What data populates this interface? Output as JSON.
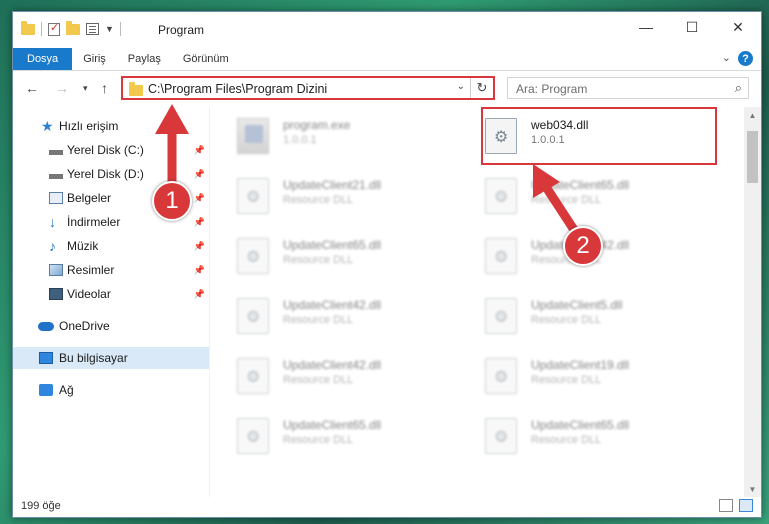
{
  "window": {
    "title": "Program",
    "controls": {
      "minimize": "—",
      "maximize": "☐",
      "close": "✕"
    }
  },
  "ribbon": {
    "tabs": [
      "Dosya",
      "Giriş",
      "Paylaş",
      "Görünüm"
    ],
    "help": "?"
  },
  "address": {
    "path": "C:\\Program Files\\Program Dizini",
    "search_placeholder": "Ara: Program"
  },
  "sidebar": {
    "items": [
      {
        "label": "Hızlı erişim",
        "icon": "star-icon"
      },
      {
        "label": "Yerel Disk (C:)",
        "icon": "disk-icon",
        "pinned": true
      },
      {
        "label": "Yerel Disk (D:)",
        "icon": "disk-icon",
        "pinned": true
      },
      {
        "label": "Belgeler",
        "icon": "documents-icon",
        "pinned": true
      },
      {
        "label": "İndirmeler",
        "icon": "download-icon",
        "pinned": true
      },
      {
        "label": "Müzik",
        "icon": "music-icon",
        "pinned": true
      },
      {
        "label": "Resimler",
        "icon": "pictures-icon",
        "pinned": true
      },
      {
        "label": "Videolar",
        "icon": "videos-icon",
        "pinned": true
      },
      {
        "label": "OneDrive",
        "icon": "cloud-icon"
      },
      {
        "label": "Bu bilgisayar",
        "icon": "computer-icon",
        "selected": true
      },
      {
        "label": "Ağ",
        "icon": "network-icon"
      }
    ]
  },
  "files": [
    {
      "name": "program.exe",
      "sub": "1.0.0.1",
      "type": "exe"
    },
    {
      "name": "web034.dll",
      "sub": "1.0.0.1",
      "type": "dll",
      "highlighted": true
    },
    {
      "name": "UpdateClient21.dll",
      "sub": "Resource DLL",
      "type": "dll"
    },
    {
      "name": "UpdateClient65.dll",
      "sub": "Resource DLL",
      "type": "dll"
    },
    {
      "name": "UpdateClient65.dll",
      "sub": "Resource DLL",
      "type": "dll"
    },
    {
      "name": "UpdateClient42.dll",
      "sub": "Resource DLL",
      "type": "dll"
    },
    {
      "name": "UpdateClient42.dll",
      "sub": "Resource DLL",
      "type": "dll"
    },
    {
      "name": "UpdateClient5.dll",
      "sub": "Resource DLL",
      "type": "dll"
    },
    {
      "name": "UpdateClient42.dll",
      "sub": "Resource DLL",
      "type": "dll"
    },
    {
      "name": "UpdateClient19.dll",
      "sub": "Resource DLL",
      "type": "dll"
    },
    {
      "name": "UpdateClient65.dll",
      "sub": "Resource DLL",
      "type": "dll"
    },
    {
      "name": "UpdateClient65.dll",
      "sub": "Resource DLL",
      "type": "dll"
    }
  ],
  "status": {
    "item_count": "199 öğe"
  },
  "annotations": [
    {
      "label": "1",
      "color": "#d9383a"
    },
    {
      "label": "2",
      "color": "#d9383a"
    }
  ]
}
